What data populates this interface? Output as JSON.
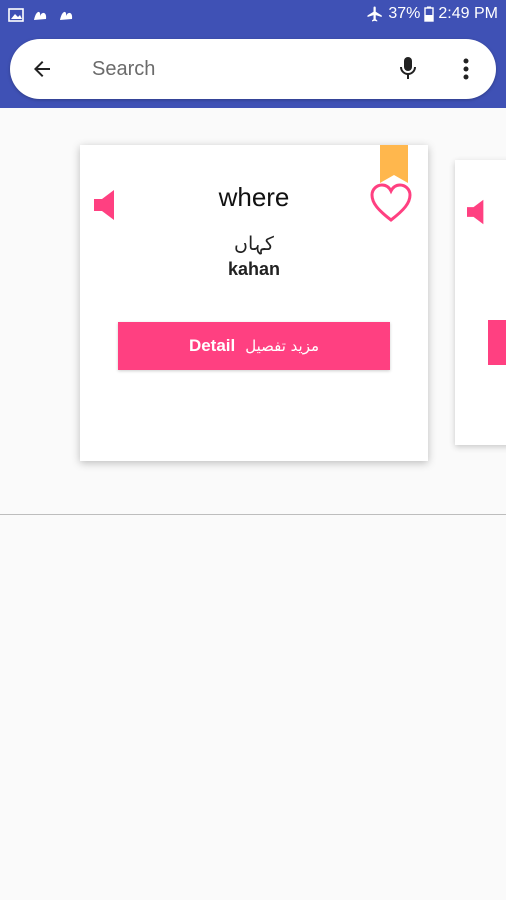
{
  "status_bar": {
    "battery": "37%",
    "time": "2:49 PM",
    "icons": [
      "gallery-icon",
      "app-icon",
      "app-icon",
      "airplane-icon",
      "battery-icon"
    ]
  },
  "search": {
    "placeholder": "Search",
    "icons": [
      "back-arrow-icon",
      "mic-icon",
      "more-vert-icon"
    ]
  },
  "card": {
    "word": "where",
    "urdu": "کہاں",
    "roman": "kahan",
    "detail_label_en": "Detail",
    "detail_label_ur": "مزید تفصیل",
    "icons": [
      "speaker-icon",
      "bookmark-icon",
      "heart-icon"
    ]
  },
  "colors": {
    "primary": "#3f51b5",
    "accent": "#ff4081",
    "bookmark": "#ffb74d"
  }
}
